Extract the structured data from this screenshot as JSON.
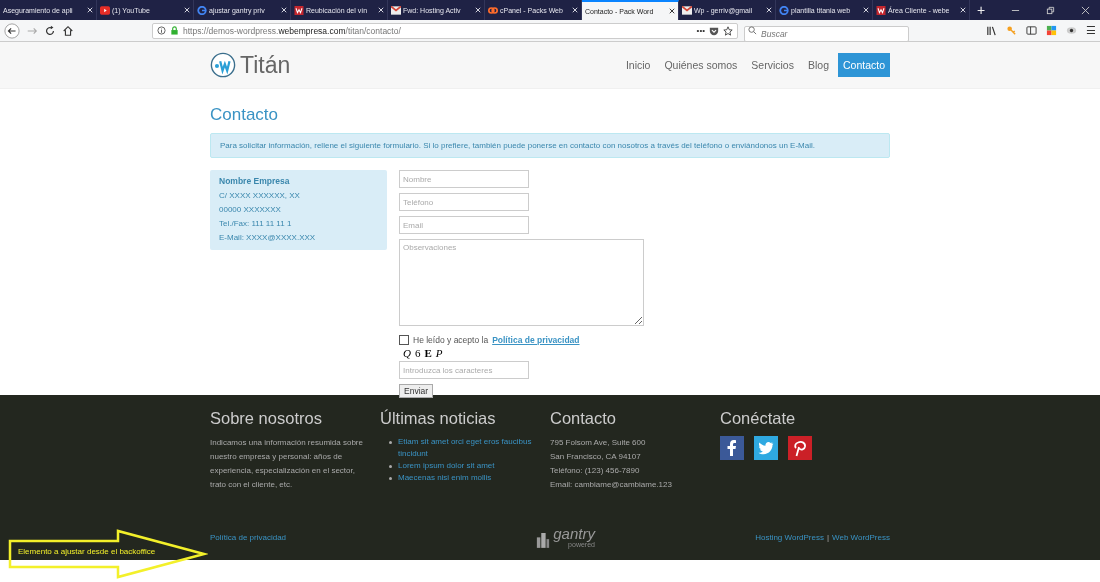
{
  "browser": {
    "tabs": [
      {
        "label": "Aseguramiento de apli",
        "kind": "plain",
        "selected": false
      },
      {
        "label": "(1) YouTube",
        "kind": "video",
        "selected": false
      },
      {
        "label": "ajustar gantry priv",
        "kind": "search",
        "selected": false
      },
      {
        "label": "Reubicación del vín",
        "kind": "site",
        "selected": false
      },
      {
        "label": "Fwd: Hosting Activ",
        "kind": "mail",
        "selected": false
      },
      {
        "label": "cPanel - Packs Web",
        "kind": "panel",
        "selected": false
      },
      {
        "label": "Contacto - Pack Word",
        "kind": "plain",
        "selected": true
      },
      {
        "label": "Wp - gerriv@gmail",
        "kind": "mail",
        "selected": false
      },
      {
        "label": "plantilla titania web",
        "kind": "search",
        "selected": false
      },
      {
        "label": "Área Cliente - webe",
        "kind": "site",
        "selected": false
      }
    ],
    "new_tab": "+",
    "url": {
      "prefix": "https://demos-wordpress.",
      "domain": "webempresa.com",
      "path": "/titan/contacto/"
    },
    "more": "•••",
    "search": {
      "placeholder": "Buscar"
    },
    "menu": "☰"
  },
  "site": {
    "logo": "Titán",
    "nav": [
      {
        "label": "Inicio",
        "selected": false
      },
      {
        "label": "Quiénes somos",
        "selected": false
      },
      {
        "label": "Servicios",
        "selected": false
      },
      {
        "label": "Blog",
        "selected": false
      },
      {
        "label": "Contacto",
        "selected": true
      }
    ]
  },
  "page": {
    "title": "Contacto",
    "notice": "Para solicitar información, rellene el siguiente formulario. Si lo prefiere, también puede ponerse en contacto con nosotros a través del teléfono o enviándonos un E-Mail.",
    "company": {
      "name": "Nombre Empresa",
      "lines": [
        "C/ XXXX XXXXXX, XX",
        "00000 XXXXXXX",
        "Tel./Fax: 111 11 11 1",
        "E-Mail: XXXX@XXXX.XXX"
      ]
    },
    "form": {
      "fields": [
        {
          "placeholder": "Nombre"
        },
        {
          "placeholder": "Teléfono"
        },
        {
          "placeholder": "Email"
        }
      ],
      "comments": {
        "placeholder": "Observaciones"
      },
      "consent": {
        "checked": false,
        "text": "He leído y acepto la",
        "link": "Política de privacidad"
      },
      "captcha": [
        "Q",
        "6",
        "E",
        "P"
      ],
      "captcha_input": {
        "placeholder": "Introduzca los caracteres"
      },
      "submit": "Enviar"
    }
  },
  "footer": {
    "about": {
      "title": "Sobre nosotros",
      "text": "Indicamos una información resumida sobre nuestro empresa y personal: años de experiencia, especialización en el sector, trato con el cliente, etc."
    },
    "news": {
      "title": "Últimas noticias",
      "items": [
        "Etiam sit amet orci eget eros faucibus tincidunt",
        "Lorem ipsum dolor sit amet",
        "Maecenas nisi enim mollis"
      ]
    },
    "contact": {
      "title": "Contacto",
      "lines": [
        "795 Folsom Ave, Suite 600",
        "San Francisco, CA 94107",
        "Teléfono: (123) 456-7890",
        "Email: cambiame@cambiame.123"
      ]
    },
    "social": {
      "title": "Conéctate",
      "links": [
        {
          "kind": "facebook",
          "color": "#3b5998"
        },
        {
          "kind": "twitter",
          "color": "#2fa9e1"
        },
        {
          "kind": "pinterest",
          "color": "#cb2027"
        }
      ]
    },
    "privacy_link": "Política de privacidad",
    "powered": {
      "name": "gantry",
      "sub": "powered"
    },
    "credits": [
      "Hosting WordPress",
      "Web WordPress"
    ],
    "credits_sep": "|"
  },
  "annotation": "Elemento a ajustar desde el backoffice"
}
